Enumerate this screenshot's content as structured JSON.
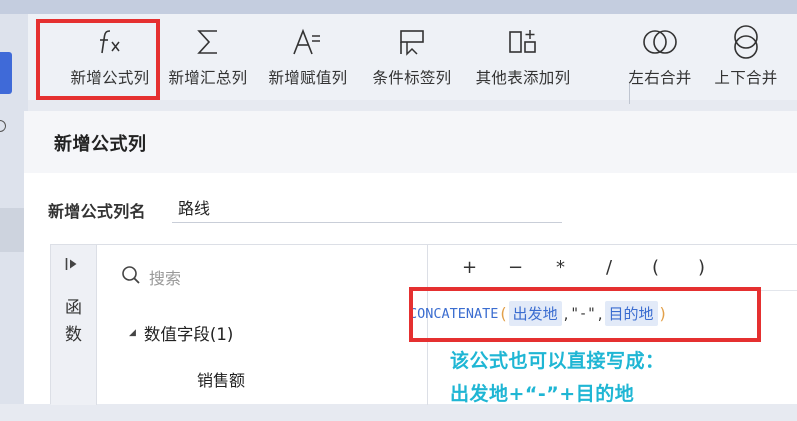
{
  "toolbar": {
    "items": [
      {
        "label": "新增公式列",
        "icon": "fx-icon"
      },
      {
        "label": "新增汇总列",
        "icon": "sigma-icon"
      },
      {
        "label": "新增赋值列",
        "icon": "assign-icon"
      },
      {
        "label": "条件标签列",
        "icon": "flag-tag-icon"
      },
      {
        "label": "其他表添加列",
        "icon": "add-column-icon"
      },
      {
        "label": "左右合并",
        "icon": "horizontal-merge-icon"
      },
      {
        "label": "上下合并",
        "icon": "vertical-merge-icon"
      }
    ]
  },
  "dialog": {
    "title": "新增公式列",
    "name_label": "新增公式列名",
    "name_value": "路线",
    "side_tab": {
      "line1": "函",
      "line2": "数",
      "icon": "collapse-arrow-icon"
    },
    "search": {
      "placeholder": "搜索",
      "icon": "search-icon"
    },
    "tree": {
      "group_label": "数值字段(1)",
      "leaf_label": "销售额"
    },
    "operators": [
      "+",
      "−",
      "*",
      "/",
      "(",
      ")"
    ],
    "formula": {
      "function": "CONCATENATE",
      "open": "(",
      "arg1": "出发地",
      "comma": ",",
      "literal": "\"-\"",
      "arg2": "目的地",
      "close": ")"
    }
  },
  "annotation": {
    "line1": "该公式也可以直接写成：",
    "line2": "出发地+“-”+目的地"
  },
  "colors": {
    "highlight_red": "#e53030",
    "annotation_cyan": "#1fb6d4",
    "field_token_bg": "#e2eaf8",
    "function_blue": "#3b6dd0"
  }
}
